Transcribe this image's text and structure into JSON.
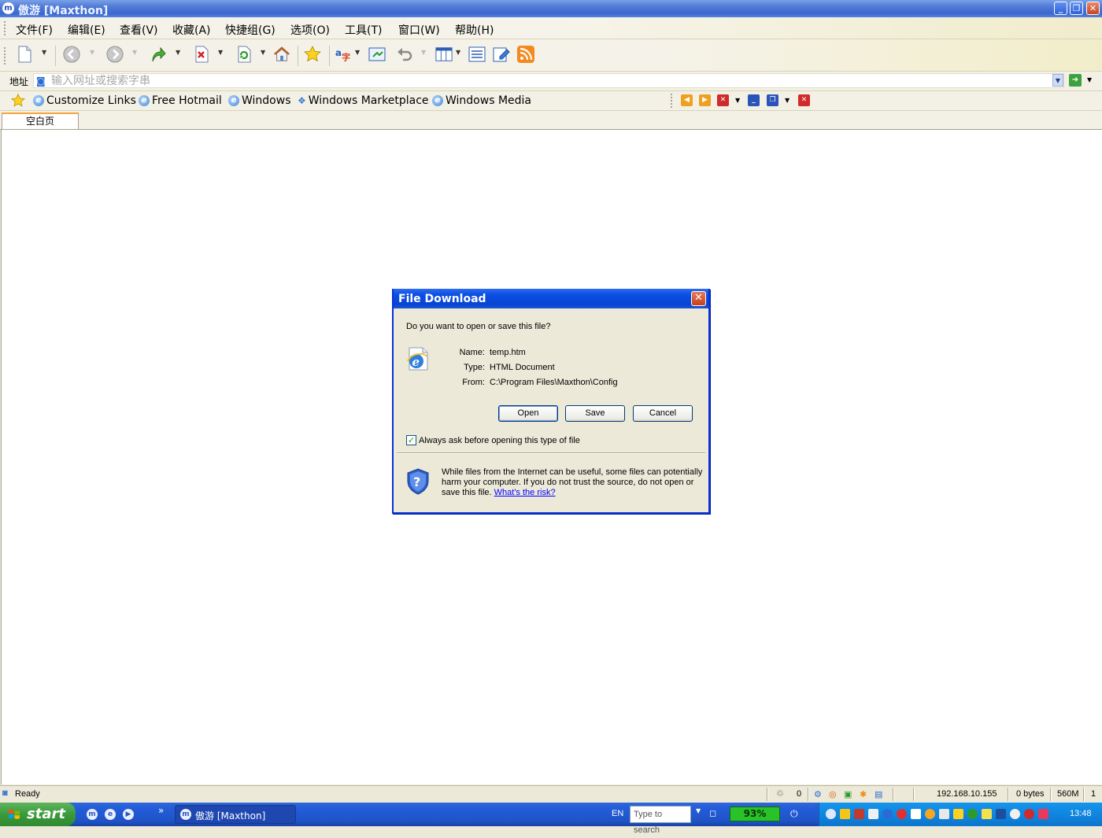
{
  "window": {
    "title": "傲游 [Maxthon]",
    "app_icon": "m"
  },
  "menu": [
    {
      "label": "文件(F)"
    },
    {
      "label": "编辑(E)"
    },
    {
      "label": "查看(V)"
    },
    {
      "label": "收藏(A)"
    },
    {
      "label": "快捷组(G)"
    },
    {
      "label": "选项(O)"
    },
    {
      "label": "工具(T)"
    },
    {
      "label": "窗口(W)"
    },
    {
      "label": "帮助(H)"
    }
  ],
  "toolbar": {
    "icons": [
      "new-page-icon",
      "back-icon",
      "forward-icon",
      "up-icon",
      "stop-icon",
      "refresh-icon",
      "home-icon",
      "favorites-icon",
      "translate-icon",
      "screenshot-icon",
      "undo-icon",
      "columns-icon",
      "list-icon",
      "edit-icon",
      "rss-icon"
    ]
  },
  "address": {
    "label": "地址",
    "placeholder": "输入网址或搜索字串"
  },
  "links": [
    {
      "label": "Customize Links"
    },
    {
      "label": "Free Hotmail"
    },
    {
      "label": "Windows"
    },
    {
      "label": "Windows Marketplace"
    },
    {
      "label": "Windows Media"
    }
  ],
  "tabs": [
    {
      "label": "空白页",
      "active": true
    }
  ],
  "dialog": {
    "title": "File Download",
    "question": "Do you want to open or save this file?",
    "fields": [
      {
        "label": "Name:",
        "value": "temp.htm"
      },
      {
        "label": "Type:",
        "value": "HTML Document"
      },
      {
        "label": "From:",
        "value": "C:\\Program Files\\Maxthon\\Config"
      }
    ],
    "buttons": {
      "open": "Open",
      "save": "Save",
      "cancel": "Cancel"
    },
    "checkbox": {
      "label": "Always ask before opening this type of file",
      "checked": true
    },
    "warning": {
      "line1": "While files from the Internet can be useful, some files can potentially",
      "line2": "harm your computer. If you do not trust the source, do not open or",
      "line3": "save this file.",
      "link": "What's the risk?"
    }
  },
  "statusbar": {
    "text": "Ready",
    "count": "0",
    "ip": "192.168.10.155",
    "bytes": "0 bytes",
    "memory": "560M",
    "extra": "1"
  },
  "taskbar": {
    "start_label": "start",
    "chevron": "»",
    "task_label": "傲游 [Maxthon]",
    "language": "EN",
    "search_placeholder": "Type to search",
    "battery": "93%",
    "clock": "13:48"
  },
  "colors": {
    "title_blue": "#0a4fe4",
    "start_green": "#3a9a3a",
    "tray_blue": "#0f86e0"
  }
}
